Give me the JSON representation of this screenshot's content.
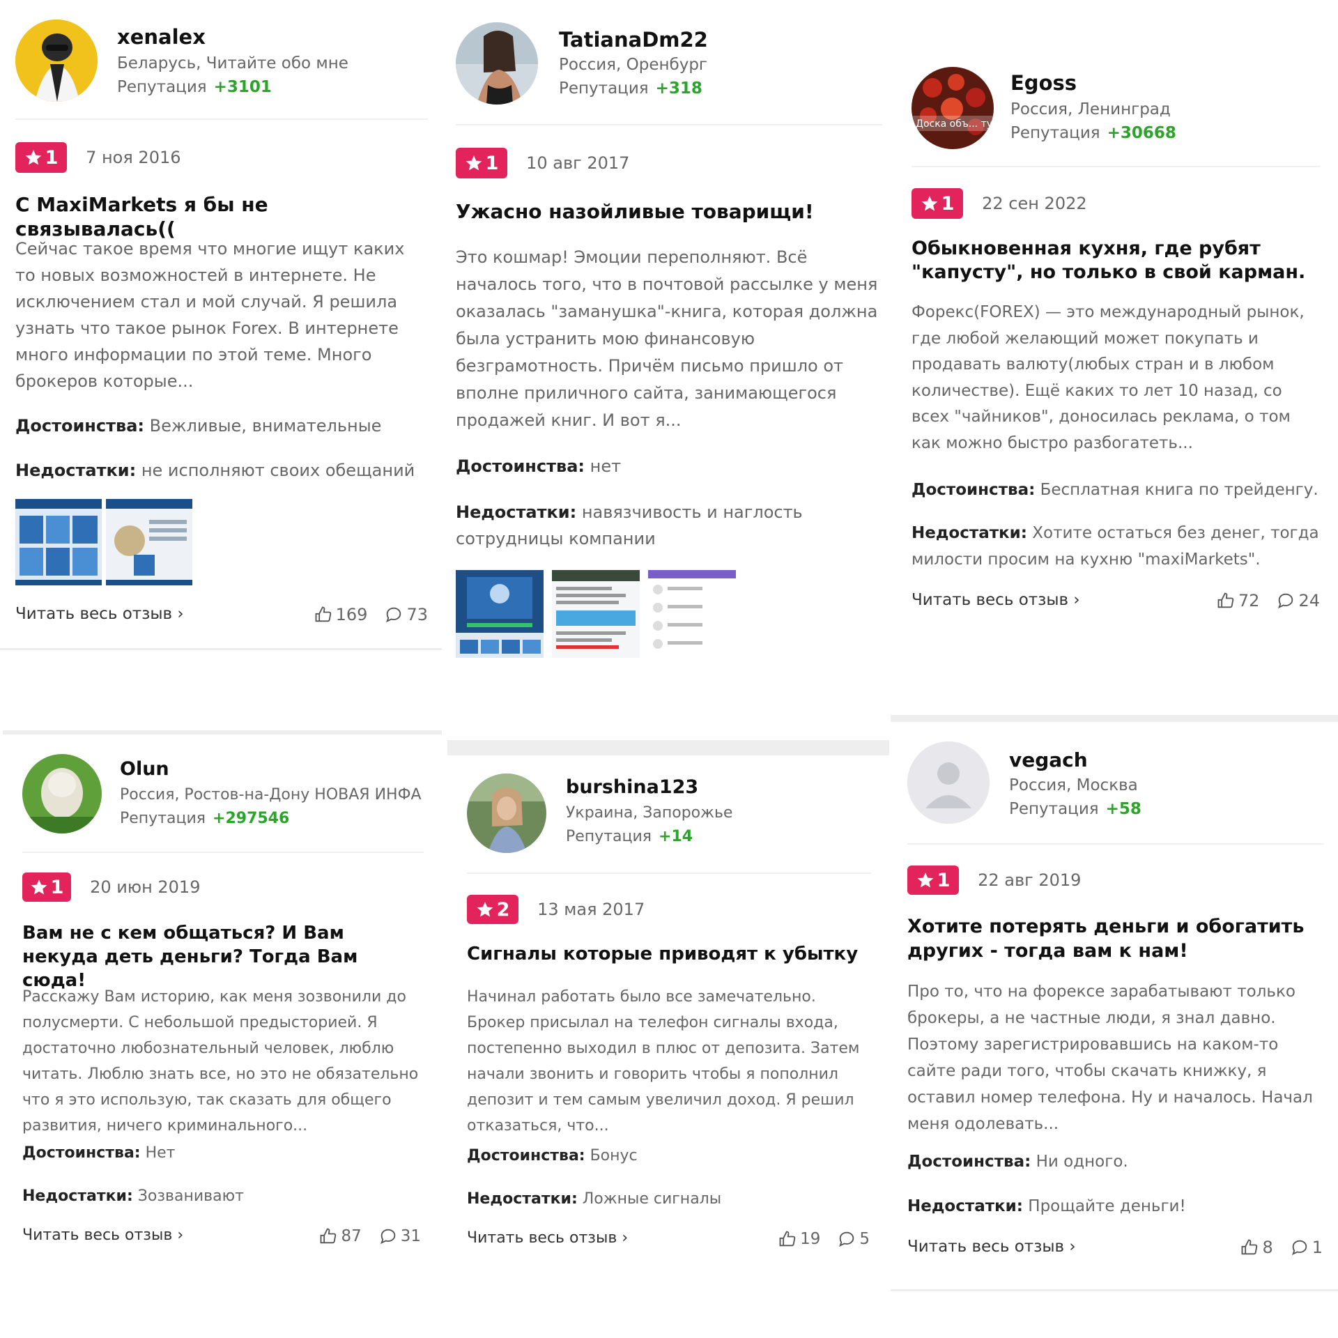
{
  "common": {
    "reputation_label": "Репутация",
    "pros_label": "Достоинства:",
    "cons_label": "Недостатки:",
    "read_more": "Читать весь отзыв",
    "read_more_arrow": "›",
    "star": "★",
    "colors": {
      "badge": "#e3235b",
      "reputation": "#2aa52a",
      "muted": "#666666"
    }
  },
  "reviews": [
    {
      "user": "xenalex",
      "location": "Беларусь, Читайте обо мне",
      "reputation": "+3101",
      "rating": "1",
      "date": "7 ноя 2016",
      "title": "С MaxiMarkets я бы не связывалась((",
      "body": "Сейчас такое время что многие ищут каких то новых возможностей в интернете. Не исключением стал и мой случай. Я решила узнать что такое рынок Forex. В интернете много информации по этой теме. Много брокеров которые...",
      "pros": "Вежливые, внимательные",
      "cons": "не исполняют своих обещаний",
      "likes": "169",
      "comments": "73"
    },
    {
      "user": "TatianaDm22",
      "location": "Россия, Оренбург",
      "reputation": "+318",
      "rating": "1",
      "date": "10 авг 2017",
      "title": "Ужасно назойливые товарищи!",
      "body": "Это кошмар! Эмоции переполняют. Всё началось того, что в почтовой рассылке у меня оказалась \"заманушка\"-книга, которая должна была устранить мою финансовую безграмотность. Причём письмо пришло от вполне приличного сайта, занимающегося продажей книг. И вот я...",
      "pros": "нет",
      "cons": "навязчивость и наглость сотрудницы компании"
    },
    {
      "user": "Egoss",
      "location": "Россия, Ленинград",
      "reputation": "+30668",
      "rating": "1",
      "date": "22 сен 2022",
      "avatar_text": "Доска объ... турал",
      "title": "Обыкновенная кухня, где рубят \"капусту\", но только в свой карман.",
      "body": "Форекс(FOREX) — это международный рынок, где любой желающий может покупать и продавать валюту(любых стран и в любом количестве). Ещё каких то лет 10 назад, со всех \"чайников\", доносилась реклама, о том как можно быстро разбогатеть...",
      "pros": "Бесплатная книга по трейденгу.",
      "cons": "Хотите остаться без денег, тогда милости просим на кухню \"maxiMarkets\".",
      "likes": "72",
      "comments": "24"
    },
    {
      "user": "Olun",
      "location": "Россия, Ростов-на-Дону НОВАЯ ИНФА",
      "reputation": "+297546",
      "rating": "1",
      "date": "20 июн 2019",
      "title": "Вам не с кем общаться? И Вам некуда деть деньги? Тогда Вам сюда!",
      "body": "Расскажу Вам историю, как меня зозвонили до полусмерти. С небольшой предысторией. Я достаточно любознательный человек, люблю читать. Люблю знать все, но это не обязательно что я это использую, так сказать для общего развития, ничего криминального...",
      "pros": "Нет",
      "cons": "Зозванивают",
      "likes": "87",
      "comments": "31"
    },
    {
      "user": "burshina123",
      "location": "Украина, Запорожье",
      "reputation": "+14",
      "rating": "2",
      "date": "13 мая 2017",
      "title": "Сигналы которые приводят к убытку",
      "body": "Начинал работать было все замечательно. Брокер присылал на телефон сигналы входа, постепенно выходил в плюс от депозита. Затем начали звонить и говорить чтобы я пополнил депозит и тем самым увеличил доход. Я решил отказаться, что...",
      "pros": "Бонус",
      "cons": "Ложные сигналы",
      "likes": "19",
      "comments": "5"
    },
    {
      "user": "vegach",
      "location": "Россия, Москва",
      "reputation": "+58",
      "rating": "1",
      "date": "22 авг 2019",
      "title": "Хотите потерять деньги и обогатить других - тогда вам к нам!",
      "body": "Про то, что на форексе зарабатывают только брокеры, а не частные люди, я знал давно. Поэтому зарегистрировавшись на каком-то сайте ради того, чтобы скачать книжку, я оставил номер телефона. Ну и началось. Начал меня одолевать...",
      "pros": "Ни одного.",
      "cons": "Прощайте деньги!",
      "likes": "8",
      "comments": "1"
    }
  ]
}
